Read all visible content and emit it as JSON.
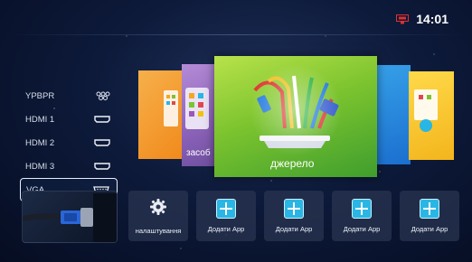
{
  "status": {
    "time": "14:01",
    "network_icon": "ethernet-icon"
  },
  "sources": [
    {
      "label": "YPBPR",
      "icon": "component-icon",
      "active": false
    },
    {
      "label": "HDMI 1",
      "icon": "hdmi-icon",
      "active": false
    },
    {
      "label": "HDMI 2",
      "icon": "hdmi-icon",
      "active": false
    },
    {
      "label": "HDMI 3",
      "icon": "hdmi-icon",
      "active": false
    },
    {
      "label": "VGA",
      "icon": "vga-icon",
      "active": true
    }
  ],
  "carousel": {
    "left_label": "засоб",
    "main_label": "джерело"
  },
  "tiles": {
    "settings_label": "налаштування",
    "add_app_1": "Додати App",
    "add_app_2": "Додати App",
    "add_app_3": "Додати App",
    "add_app_4": "Додати App"
  },
  "colors": {
    "accent": "#2ab6e4",
    "main_card": "#7cc42f",
    "background": "#0d1a3a"
  }
}
